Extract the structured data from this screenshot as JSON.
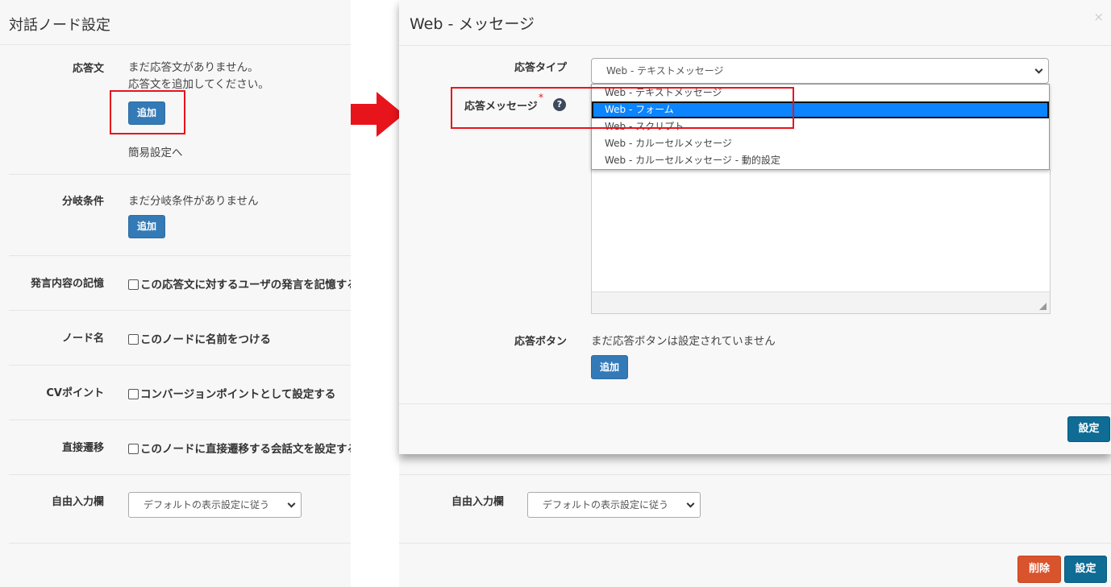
{
  "left_panel": {
    "title": "対話ノード設定",
    "response": {
      "label": "応答文",
      "empty_line1": "まだ応答文がありません。",
      "empty_line2": "応答文を追加してください。",
      "add_label": "追加",
      "simple_link": "簡易設定へ"
    },
    "branch": {
      "label": "分岐条件",
      "empty": "まだ分岐条件がありません",
      "add_label": "追加"
    },
    "memory": {
      "label": "発言内容の記憶",
      "checkbox": "この応答文に対するユーザの発言を記憶する"
    },
    "node_name": {
      "label": "ノード名",
      "checkbox": "このノードに名前をつける"
    },
    "cv_point": {
      "label": "CVポイント",
      "checkbox": "コンバージョンポイントとして設定する"
    },
    "direct": {
      "label": "直接遷移",
      "checkbox": "このノードに直接遷移する会話文を設定する"
    },
    "free_input": {
      "label": "自由入力欄",
      "select_value": "デフォルトの表示設定に従う"
    }
  },
  "modal": {
    "title": "Web - メッセージ",
    "close_symbol": "×",
    "type_label": "応答タイプ",
    "type_value": "Web - テキストメッセージ",
    "message_label": "応答メッセージ",
    "required_mark": "*",
    "help_symbol": "?",
    "options": [
      "Web - テキストメッセージ",
      "Web - フォーム",
      "Web - スクリプト",
      "Web - カルーセルメッセージ",
      "Web - カルーセルメッセージ - 動的設定"
    ],
    "buttons_label": "応答ボタン",
    "buttons_empty": "まだ応答ボタンは設定されていません",
    "add_label": "追加",
    "submit_label": "設定"
  },
  "right_bottom": {
    "free_input_label": "自由入力欄",
    "select_value": "デフォルトの表示設定に従う",
    "delete_label": "削除",
    "submit_label": "設定"
  },
  "colors": {
    "highlight": "#e8141c",
    "primary": "#337ab7",
    "selected_option": "#0a84ff",
    "danger": "#d9532c",
    "teal": "#0e6c95"
  }
}
